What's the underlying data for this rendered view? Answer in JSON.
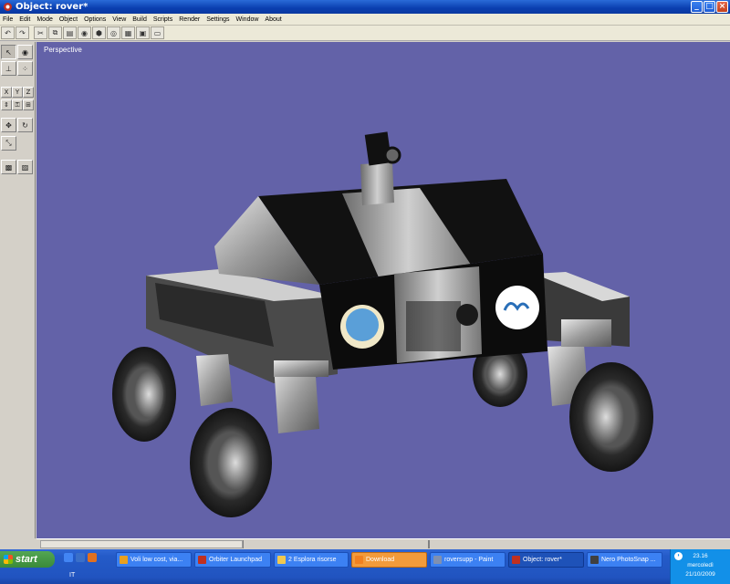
{
  "window": {
    "title": "Object: rover*"
  },
  "menu": [
    "File",
    "Edit",
    "Mode",
    "Object",
    "Options",
    "View",
    "Build",
    "Scripts",
    "Render",
    "Settings",
    "Window",
    "About"
  ],
  "toolbar_icons": [
    "undo-icon",
    "redo-icon",
    "cut-icon",
    "copy-icon",
    "paste-icon",
    "render-icon",
    "wireframe-icon",
    "shaded-icon",
    "texture-icon",
    "camera-icon",
    "light-icon"
  ],
  "left_panel": {
    "axis_labels": [
      "X",
      "Y",
      "Z"
    ]
  },
  "viewport": {
    "label": "Perspective",
    "background": "#6362a8"
  },
  "taskbar": {
    "start_label": "start",
    "language": "IT",
    "tasks": [
      {
        "label": "Voli low cost, via...",
        "icon_color": "#e8a020"
      },
      {
        "label": "Orbiter Launchpad",
        "icon_color": "#c03020"
      },
      {
        "label": "2 Esplora risorse",
        "icon_color": "#f0c850"
      },
      {
        "label": "Download",
        "icon_color": "#f08020"
      },
      {
        "label": "roversupp - Paint",
        "icon_color": "#8090b0"
      },
      {
        "label": "Object: rover*",
        "icon_color": "#c03020"
      },
      {
        "label": "Nero PhotoSnap ...",
        "icon_color": "#404040"
      }
    ],
    "tray": {
      "time": "23.16",
      "day": "mercoledì",
      "date": "21/10/2009"
    }
  }
}
